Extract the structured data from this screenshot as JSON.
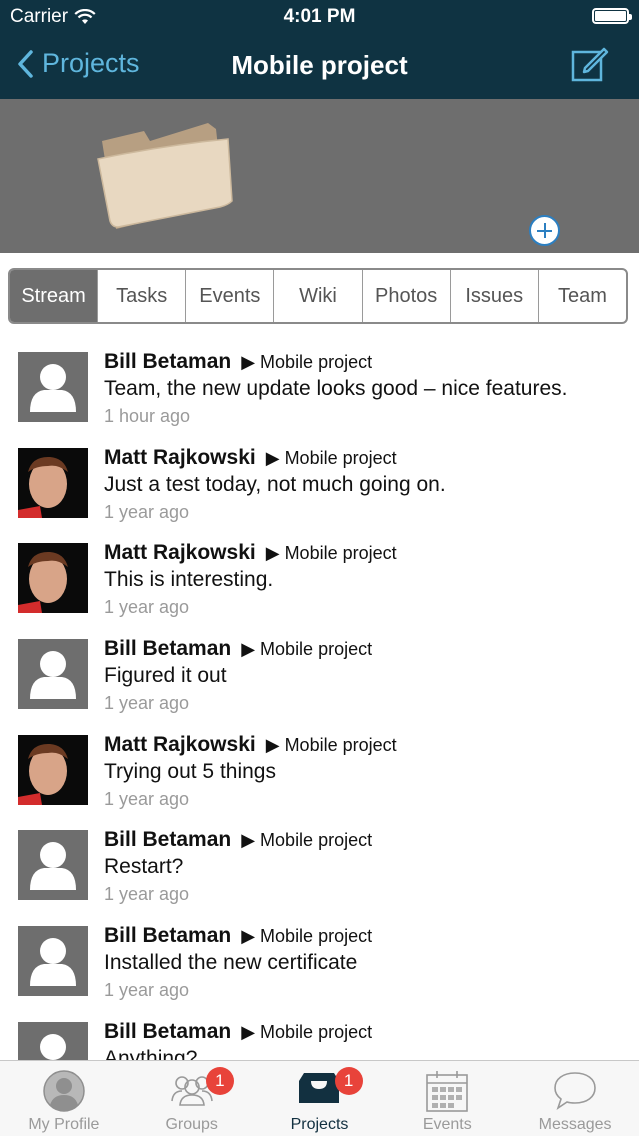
{
  "status": {
    "carrier": "Carrier",
    "time": "4:01 PM"
  },
  "nav": {
    "back_label": "Projects",
    "title": "Mobile project"
  },
  "tabs": [
    {
      "label": "Stream",
      "active": true
    },
    {
      "label": "Tasks",
      "active": false
    },
    {
      "label": "Events",
      "active": false
    },
    {
      "label": "Wiki",
      "active": false
    },
    {
      "label": "Photos",
      "active": false
    },
    {
      "label": "Issues",
      "active": false
    },
    {
      "label": "Team",
      "active": false
    }
  ],
  "stream": [
    {
      "author": "Bill Betaman",
      "project": "Mobile project",
      "message": "Team, the new update looks good – nice features.",
      "ago": "1 hour ago",
      "avatar": "default"
    },
    {
      "author": "Matt Rajkowski",
      "project": "Mobile project",
      "message": "Just a test today, not much going on.",
      "ago": "1 year ago",
      "avatar": "photo"
    },
    {
      "author": "Matt Rajkowski",
      "project": "Mobile project",
      "message": "This is interesting.",
      "ago": "1 year ago",
      "avatar": "photo"
    },
    {
      "author": "Bill Betaman",
      "project": "Mobile project",
      "message": "Figured it out",
      "ago": "1 year ago",
      "avatar": "default"
    },
    {
      "author": "Matt Rajkowski",
      "project": "Mobile project",
      "message": "Trying out 5 things",
      "ago": "1 year ago",
      "avatar": "photo"
    },
    {
      "author": "Bill Betaman",
      "project": "Mobile project",
      "message": "Restart?",
      "ago": "1 year ago",
      "avatar": "default"
    },
    {
      "author": "Bill Betaman",
      "project": "Mobile project",
      "message": "Installed the new certificate",
      "ago": "1 year ago",
      "avatar": "default"
    },
    {
      "author": "Bill Betaman",
      "project": "Mobile project",
      "message": "Anything?",
      "ago": "",
      "avatar": "default"
    }
  ],
  "tabbar": [
    {
      "label": "My Profile",
      "icon": "profile-icon",
      "badge": null,
      "active": false
    },
    {
      "label": "Groups",
      "icon": "groups-icon",
      "badge": "1",
      "active": false
    },
    {
      "label": "Projects",
      "icon": "projects-icon",
      "badge": "1",
      "active": true
    },
    {
      "label": "Events",
      "icon": "calendar-icon",
      "badge": null,
      "active": false
    },
    {
      "label": "Messages",
      "icon": "messages-icon",
      "badge": null,
      "active": false
    }
  ],
  "colors": {
    "header": "#0f3342",
    "accent": "#5fb6dd",
    "badge": "#e8433a",
    "tab_active": "#6e6e6e"
  }
}
